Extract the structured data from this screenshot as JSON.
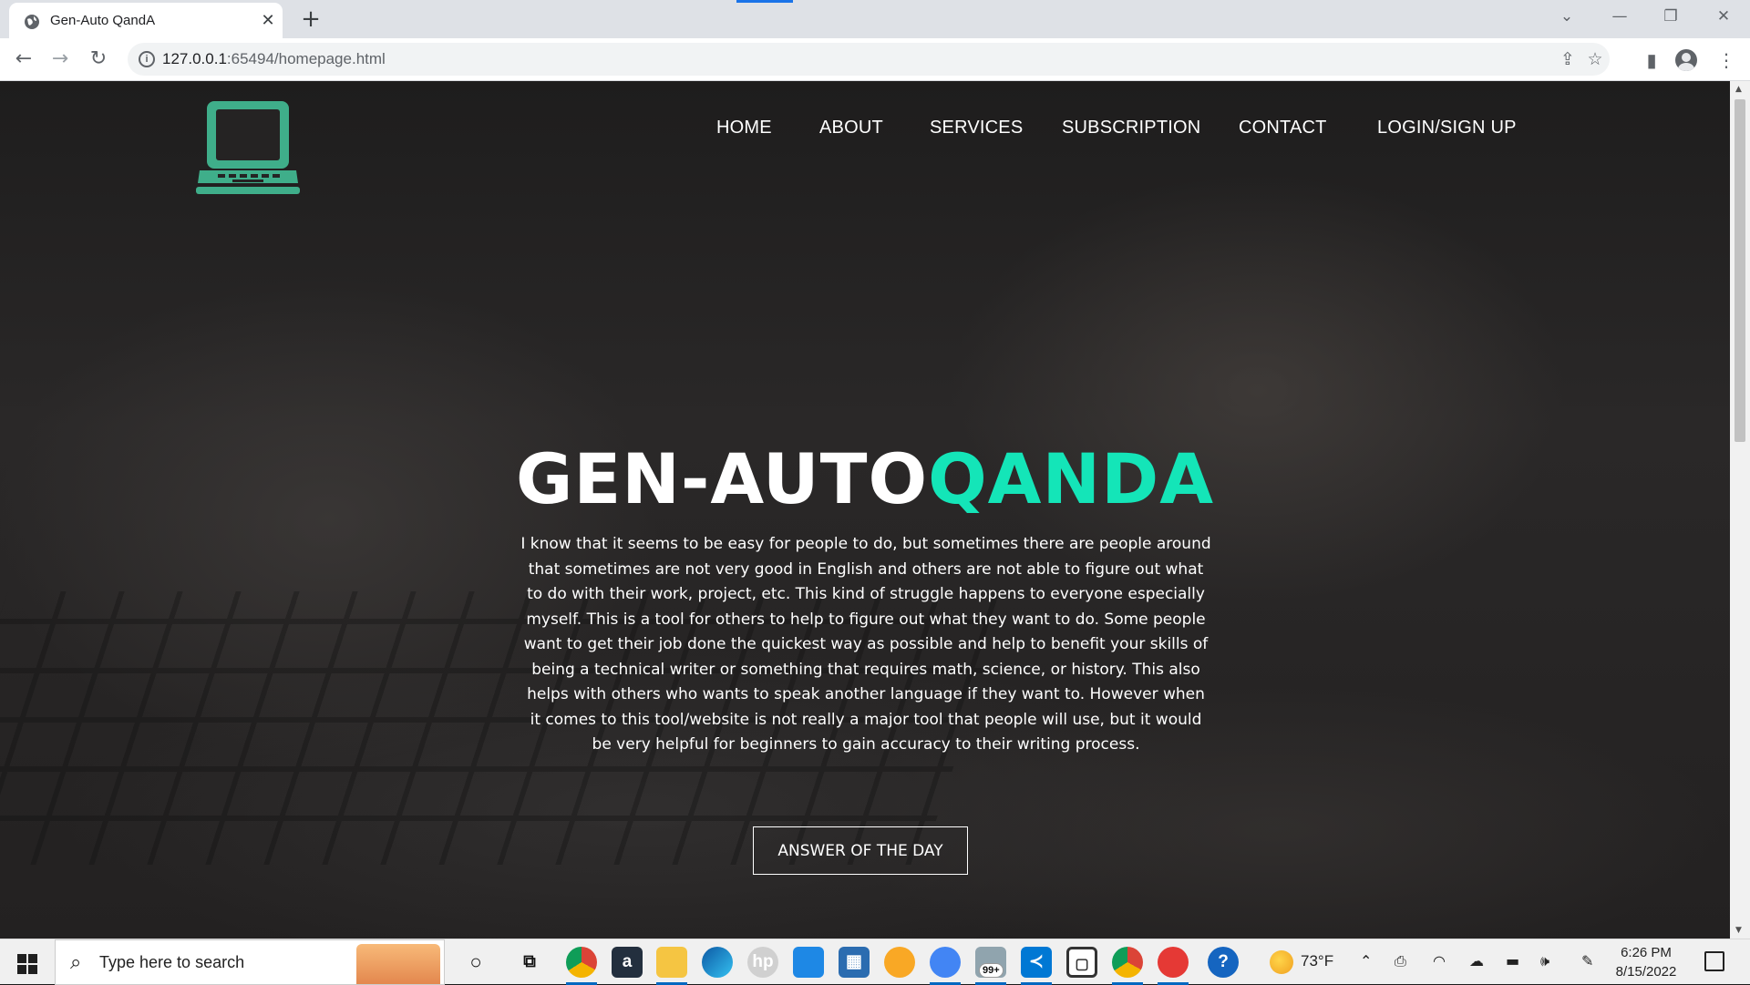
{
  "browser": {
    "tab_title": "Gen-Auto QandA",
    "url_host": "127.0.0.1",
    "url_rest": ":65494/homepage.html"
  },
  "nav": {
    "items": [
      {
        "label": "HOME"
      },
      {
        "label": "ABOUT"
      },
      {
        "label": "SERVICES"
      },
      {
        "label": "SUBSCRIPTION"
      },
      {
        "label": "CONTACT"
      },
      {
        "label": "LOGIN/SIGN UP"
      }
    ]
  },
  "hero": {
    "title_part1": "GEN-AUTO",
    "title_part2": "QANDA",
    "description": "I know that it seems to be easy for people to do, but sometimes there are people around that sometimes are not very good in English and others are not able to figure out what to do with their work, project, etc. This kind of struggle happens to everyone especially myself. This is a tool for others to help to figure out what they want to do. Some people want to get their job done the quickest way as possible and help to benefit your skills of being a technical writer or something that requires math, science, or history. This also helps with others who wants to speak another language if they want to. However when it comes to this tool/website is not really a major tool that people will use, but it would be very helpful for beginners to gain accuracy to their writing process.",
    "cta_label": "ANSWER OF THE DAY"
  },
  "colors": {
    "accent": "#14e5b8",
    "logo": "#3fae8a"
  },
  "taskbar": {
    "search_placeholder": "Type here to search",
    "badge": "99+",
    "temperature": "73°F",
    "time": "6:26 PM",
    "date": "8/15/2022"
  }
}
